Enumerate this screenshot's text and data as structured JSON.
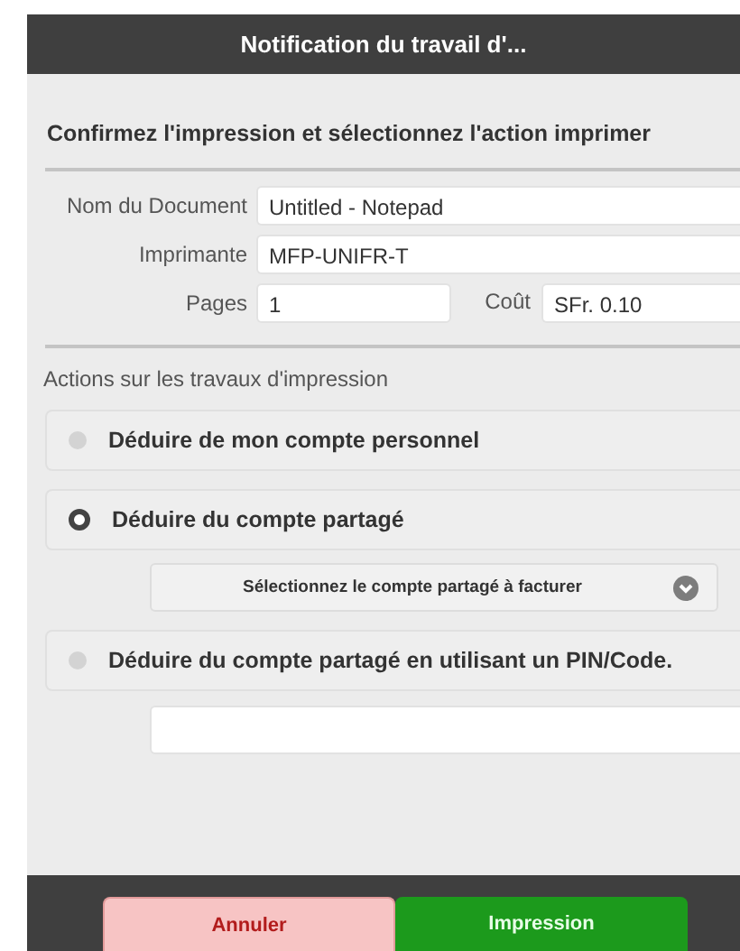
{
  "dialog": {
    "title": "Notification du travail d'...",
    "heading": "Confirmez l'impression et sélectionnez l'action imprimer"
  },
  "fields": [
    {
      "label": "Nom du Document",
      "value": "Untitled - Notepad"
    },
    {
      "label": "Imprimante",
      "value": "MFP-UNIFR-T"
    }
  ],
  "pages": {
    "label": "Pages",
    "value": "1"
  },
  "cost": {
    "label": "Coût",
    "value": "SFr. 0.10"
  },
  "actions_heading": "Actions sur les travaux d'impression",
  "options": [
    {
      "kind": "plain",
      "label": "Déduire de mon compte personnel",
      "selected": false
    },
    {
      "kind": "account-select",
      "label": "Déduire du compte partagé",
      "selected": true,
      "select_label": "Sélectionnez le compte partagé à facturer"
    },
    {
      "kind": "pin",
      "label": "Déduire du compte partagé en utilisant un PIN/Code.",
      "selected": false
    }
  ],
  "buttons": [
    {
      "kind": "cancel",
      "label": "Annuler"
    },
    {
      "kind": "confirm",
      "label": "Impression"
    }
  ]
}
